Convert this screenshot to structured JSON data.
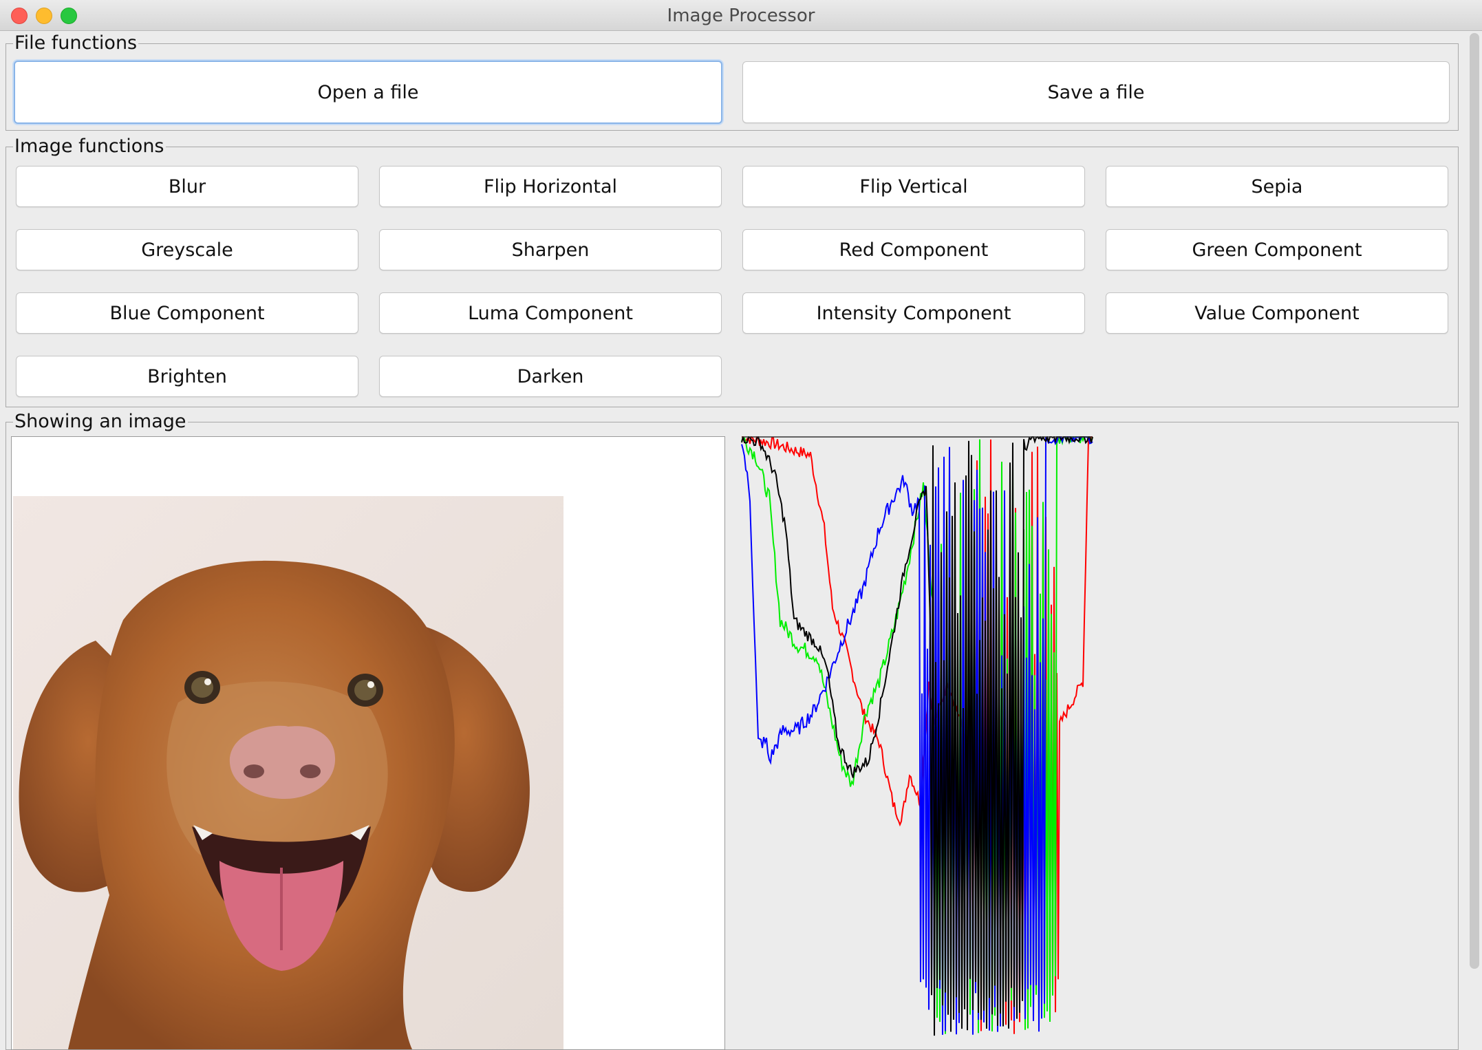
{
  "window": {
    "title": "Image Processor"
  },
  "file_functions": {
    "legend": "File functions",
    "open_label": "Open a file",
    "save_label": "Save a file"
  },
  "image_functions": {
    "legend": "Image functions",
    "buttons": [
      "Blur",
      "Flip Horizontal",
      "Flip Vertical",
      "Sepia",
      "Greyscale",
      "Sharpen",
      "Red Component",
      "Green Component",
      "Blue Component",
      "Luma Component",
      "Intensity Component",
      "Value Component",
      "Brighten",
      "Darken"
    ]
  },
  "display": {
    "legend": "Showing an image"
  },
  "histogram_colors": {
    "red": "#ff0000",
    "green": "#00ee00",
    "blue": "#0000ff",
    "intensity": "#000000"
  }
}
